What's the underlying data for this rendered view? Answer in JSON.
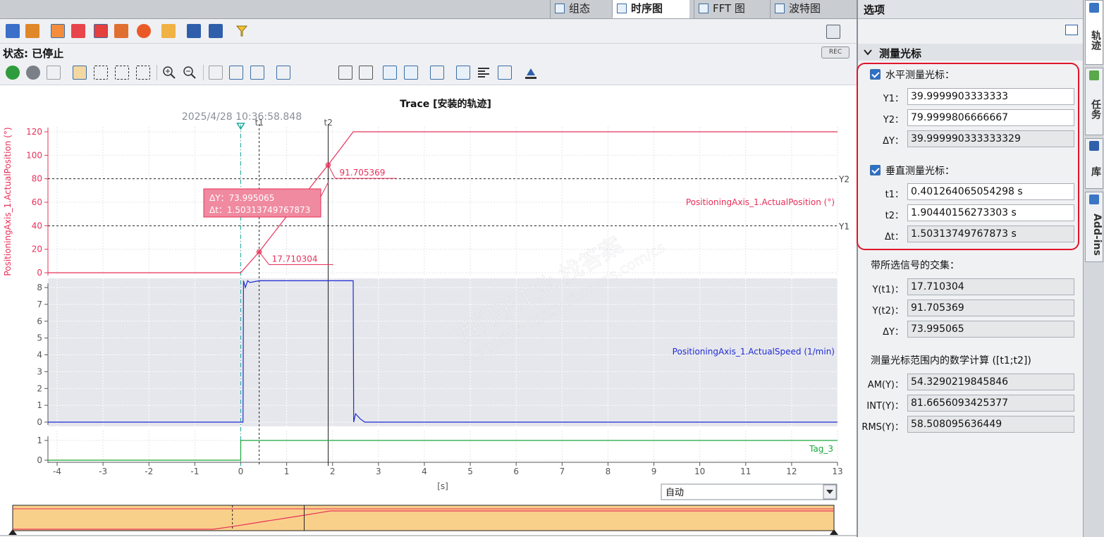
{
  "tabs": [
    {
      "label": "组态",
      "active": false
    },
    {
      "label": "时序图",
      "active": true
    },
    {
      "label": "FFT 图",
      "active": false
    },
    {
      "label": "波特图",
      "active": false
    }
  ],
  "status": {
    "text": "状态: 已停止",
    "rec": "REC"
  },
  "chart": {
    "title": "Trace [安装的轨迹]",
    "timestamp": "2025/4/28 10:36:58.848",
    "t1_label": "t1",
    "t2_label": "t2",
    "y1_label": "Y1",
    "y2_label": "Y2",
    "xlabel": "[s]",
    "pos_axis_label": "PositioningAxis_1.ActualPosition (°)",
    "pos_series_label": "PositioningAxis_1.ActualPosition (°)",
    "speed_series_label": "PositioningAxis_1.ActualSpeed (1/min)",
    "tag_series_label": "Tag_3",
    "marker_t1_value": "17.710304",
    "marker_t2_value": "91.705369",
    "delta_box_dy": "ΔY：73.995065",
    "delta_box_dt": "Δt：1.50313749767873",
    "zoom_select": "自动",
    "watermark_cn": "西门子工业  找答案",
    "watermark_url": "support.industry.siemens.com/cs",
    "colors": {
      "position": "#e8305a",
      "speed": "#1f2bd6",
      "tag": "#19a83a",
      "cursor_t0": "#1aa89a",
      "overview_bg": "#f9d08a"
    }
  },
  "chart_data": [
    {
      "type": "line",
      "name_ref": "PositioningAxis_1.ActualPosition (°)",
      "x": [
        -4.2,
        0.0,
        0.4,
        1.0,
        1.5,
        1.9,
        2.2,
        2.45,
        13.0
      ],
      "y": [
        0,
        0,
        17.71,
        48,
        72,
        91.7,
        107,
        120,
        120
      ],
      "ylim": [
        0,
        120
      ],
      "yticks": [
        0,
        20,
        40,
        60,
        80,
        100,
        120
      ]
    },
    {
      "type": "line",
      "name_ref": "PositioningAxis_1.ActualSpeed (1/min)",
      "x": [
        -4.2,
        0.05,
        0.06,
        0.1,
        0.15,
        0.2,
        0.3,
        0.4,
        2.45,
        2.46,
        2.5,
        2.6,
        2.7,
        13.0
      ],
      "y": [
        0,
        0,
        8.4,
        8.0,
        8.4,
        8.3,
        8.35,
        8.4,
        8.4,
        0,
        0.5,
        0.2,
        0,
        0
      ],
      "ylim": [
        0,
        8
      ],
      "yticks": [
        0,
        1,
        2,
        3,
        4,
        5,
        6,
        7,
        8
      ]
    },
    {
      "type": "line",
      "name_ref": "Tag_3",
      "x": [
        -4.2,
        0.0,
        0.0,
        13.0
      ],
      "y": [
        0,
        0,
        1,
        1
      ],
      "ylim": [
        0,
        1
      ],
      "yticks": [
        0,
        1
      ]
    }
  ],
  "xaxis": {
    "ticks": [
      -4,
      -3,
      -2,
      -1,
      0,
      1,
      2,
      3,
      4,
      5,
      6,
      7,
      8,
      9,
      10,
      11,
      12,
      13
    ],
    "range": [
      -4.2,
      13.0
    ]
  },
  "cursors": {
    "t0": 0.0,
    "t1": 0.401264,
    "t2": 1.904402,
    "y1": 40,
    "y2": 80
  },
  "options": {
    "title": "选项",
    "section": "测量光标",
    "horizontal": {
      "label": "水平测量光标：",
      "checked": true,
      "rows": [
        {
          "label": "Y1：",
          "value": "39.9999903333333",
          "readonly": false
        },
        {
          "label": "Y2：",
          "value": "79.9999806666667",
          "readonly": false
        },
        {
          "label": "ΔY：",
          "value": "39.999990333333329",
          "readonly": true
        }
      ]
    },
    "vertical": {
      "label": "垂直测量光标：",
      "checked": true,
      "rows": [
        {
          "label": "t1：",
          "value": "0.401264065054298 s",
          "readonly": false
        },
        {
          "label": "t2：",
          "value": "1.90440156273303 s",
          "readonly": false
        },
        {
          "label": "Δt：",
          "value": "1.50313749767873 s",
          "readonly": true
        }
      ]
    },
    "intersect_title": "带所选信号的交集：",
    "intersect": [
      {
        "label": "Y(t1)：",
        "value": "17.710304"
      },
      {
        "label": "Y(t2)：",
        "value": "91.705369"
      },
      {
        "label": "ΔY：",
        "value": "73.995065"
      }
    ],
    "math_title": "测量光标范围内的数学计算 ([t1;t2])",
    "math": [
      {
        "label": "AM(Y)：",
        "value": "54.3290219845846"
      },
      {
        "label": "INT(Y)：",
        "value": "81.6656093425377"
      },
      {
        "label": "RMS(Y)：",
        "value": "58.508095636449"
      }
    ]
  },
  "side_tabs": [
    {
      "label": "轨迹"
    },
    {
      "label": "任务"
    },
    {
      "label": "库"
    },
    {
      "label": "Add-ins"
    }
  ]
}
